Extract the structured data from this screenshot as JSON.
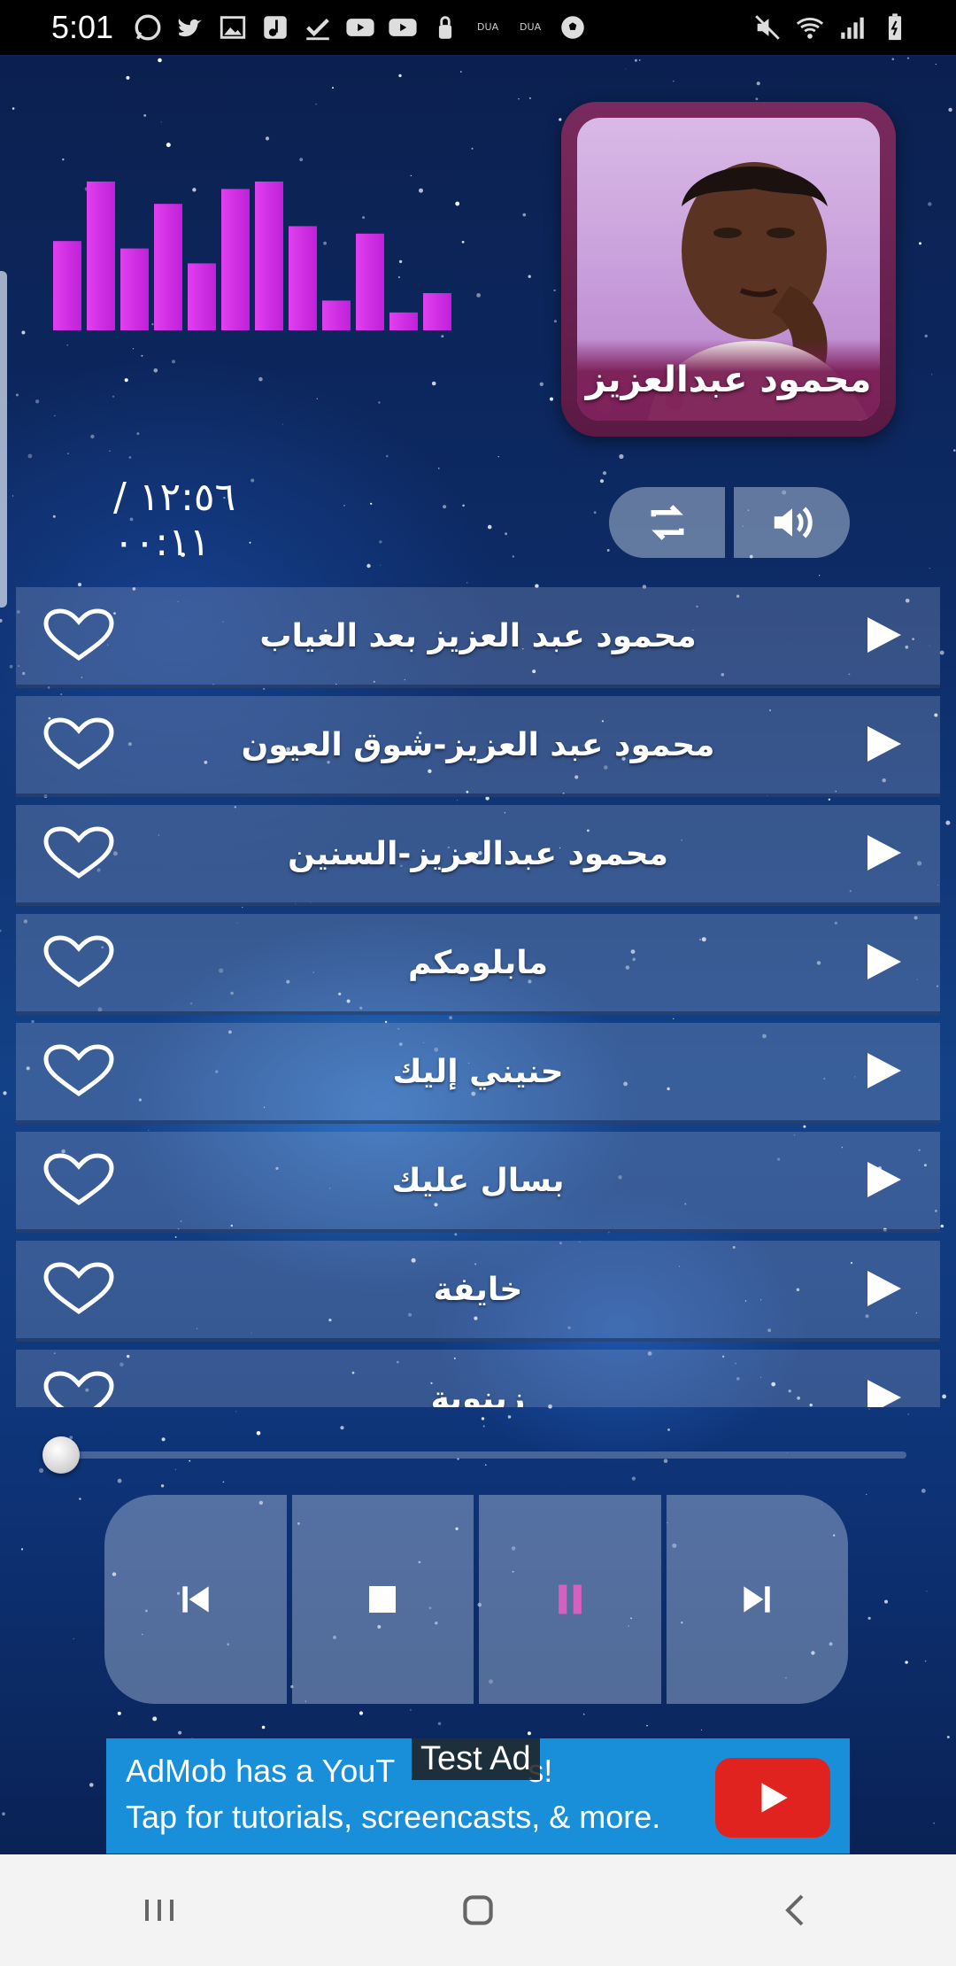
{
  "status_bar": {
    "time": "5:01",
    "left_icons": [
      "whatsapp-icon",
      "twitter-icon",
      "image-icon",
      "music-icon",
      "check-icon",
      "youtube-icon",
      "youtube-icon",
      "lock-icon",
      "dua-icon",
      "dua-icon",
      "soccer-icon"
    ],
    "dua_label": "DUA",
    "right_icons": [
      "mute-icon",
      "wifi-icon",
      "signal-icon",
      "battery-icon"
    ]
  },
  "album": {
    "artist_name": "محمود عبدالعزيز"
  },
  "player": {
    "time_readout": "١٢:٥٦ / ٠٠:١١",
    "seek_progress": 0.0,
    "visualizer_levels": [
      0.6,
      1.0,
      0.55,
      0.85,
      0.45,
      0.95,
      1.0,
      0.7,
      0.2,
      0.65,
      0.12,
      0.25
    ],
    "accent_color": "#c020d8",
    "pause_color": "#d65fc0"
  },
  "songs": [
    {
      "title": "محمود عبد العزيز بعد الغياب"
    },
    {
      "title": "محمود عبد العزيز-شوق العيون"
    },
    {
      "title": "محمود عبدالعزيز-السنين"
    },
    {
      "title": "مابلومكم"
    },
    {
      "title": "حنيني إليك"
    },
    {
      "title": "بسال عليك"
    },
    {
      "title": "خايفة"
    },
    {
      "title": "زينوبة"
    }
  ],
  "ad": {
    "line1": "AdMob has a YouT",
    "line1_end": "s!",
    "test_tag": "Test Ad",
    "line2": "Tap for tutorials, screencasts, & more."
  }
}
